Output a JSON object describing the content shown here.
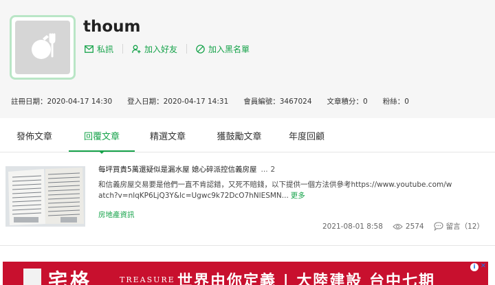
{
  "profile": {
    "username": "thoum",
    "actions": [
      {
        "label": "私訊",
        "icon": "mail-icon"
      },
      {
        "label": "加入好友",
        "icon": "add-friend-icon"
      },
      {
        "label": "加入黑名單",
        "icon": "block-icon"
      }
    ],
    "info": [
      {
        "label": "註冊日期",
        "value": "2020-04-17 14:30"
      },
      {
        "label": "登入日期",
        "value": "2020-04-17 14:31"
      },
      {
        "label": "會員編號",
        "value": "3467024"
      },
      {
        "label": "文章積分",
        "value": "0"
      },
      {
        "label": "粉絲",
        "value": "0"
      }
    ]
  },
  "tabs": [
    {
      "label": "發佈文章",
      "active": false
    },
    {
      "label": "回覆文章",
      "active": true
    },
    {
      "label": "精選文章",
      "active": false
    },
    {
      "label": "獲鼓勵文章",
      "active": false
    },
    {
      "label": "年度回顧",
      "active": false
    }
  ],
  "post": {
    "title": "每坪買貴5萬還疑似是漏水屋 媳心碎派控信義房屋",
    "ellipsis": "...",
    "reply_count": "2",
    "excerpt": "和信義房屋交易要是他們一直不肯認錯，又死不賠錢，以下提供一個方法供參考https://www.youtube.com/watch?v=nlqKP6LjQ3Y&lc=Ugwc9k72DcO7hNlESMN...",
    "more_label": "更多",
    "board": "房地產資訊",
    "date": "2021-08-01 8:58",
    "views": "2574",
    "comments": "留言（12）"
  },
  "ad": {
    "logo": "宅格",
    "brand": "TREASURE",
    "slogan": "世界由你定義 | 大陸建設 台中七期",
    "info_glyph": "i",
    "close_glyph": "✕"
  },
  "colors": {
    "accent": "#16a34a",
    "avatar_border": "#b9e6c6",
    "ad_red": "#c8102e"
  }
}
